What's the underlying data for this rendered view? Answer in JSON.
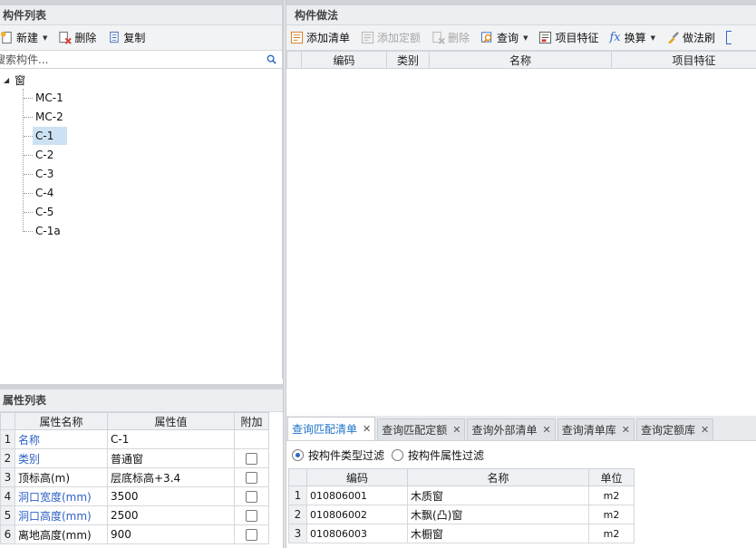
{
  "component_list": {
    "title": "构件列表",
    "toolbar": {
      "new_label": "新建",
      "delete_label": "删除",
      "copy_label": "复制"
    },
    "search_placeholder": "搜索构件...",
    "tree": {
      "root": "窗",
      "items": [
        "MC-1",
        "MC-2",
        "C-1",
        "C-2",
        "C-3",
        "C-4",
        "C-5",
        "C-1a"
      ],
      "selected": "C-1"
    }
  },
  "property_list": {
    "title": "属性列表",
    "headers": {
      "index": "",
      "name": "属性名称",
      "value": "属性值",
      "extra": "附加"
    },
    "rows": [
      {
        "index": "1",
        "name": "名称",
        "value": "C-1",
        "blue": true,
        "checkbox": false
      },
      {
        "index": "2",
        "name": "类别",
        "value": "普通窗",
        "blue": true,
        "checkbox": true
      },
      {
        "index": "3",
        "name": "顶标高(m)",
        "value": "层底标高+3.4",
        "blue": false,
        "checkbox": true
      },
      {
        "index": "4",
        "name": "洞口宽度(mm)",
        "value": "3500",
        "blue": true,
        "checkbox": true
      },
      {
        "index": "5",
        "name": "洞口高度(mm)",
        "value": "2500",
        "blue": true,
        "checkbox": true
      },
      {
        "index": "6",
        "name": "离地高度(mm)",
        "value": "900",
        "blue": false,
        "checkbox": true
      }
    ]
  },
  "method_panel": {
    "title": "构件做法",
    "toolbar": {
      "add_list": "添加清单",
      "add_quota": "添加定额",
      "delete": "删除",
      "query": "查询",
      "item_feature": "项目特征",
      "convert": "换算",
      "brush": "做法刷"
    },
    "headers": {
      "index": "",
      "code": "编码",
      "category": "类别",
      "name": "名称",
      "feature": "项目特征"
    }
  },
  "query_panel": {
    "tabs": [
      "查询匹配清单",
      "查询匹配定额",
      "查询外部清单",
      "查询清单库",
      "查询定额库"
    ],
    "active_tab": 0,
    "filters": {
      "by_type": "按构件类型过滤",
      "by_attr": "按构件属性过滤"
    },
    "headers": {
      "index": "",
      "code": "编码",
      "name": "名称",
      "unit": "单位"
    },
    "rows": [
      {
        "index": "1",
        "code": "010806001",
        "name": "木质窗",
        "unit": "m2"
      },
      {
        "index": "2",
        "code": "010806002",
        "name": "木飘(凸)窗",
        "unit": "m2"
      },
      {
        "index": "3",
        "code": "010806003",
        "name": "木橱窗",
        "unit": "m2"
      }
    ]
  }
}
